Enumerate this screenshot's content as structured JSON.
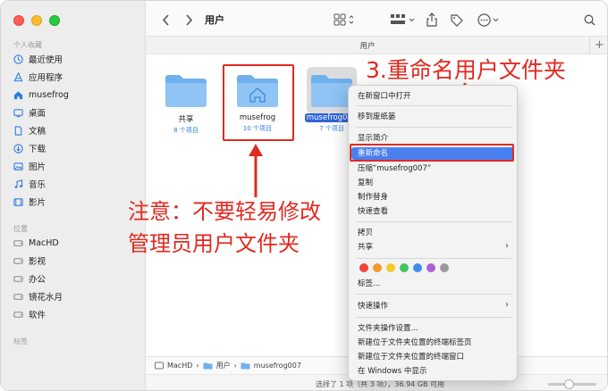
{
  "window": {
    "title": "用户",
    "path_header": "用户"
  },
  "sidebar": {
    "favorites_label": "个人收藏",
    "favorites": [
      {
        "label": "最近使用",
        "icon": "clock-icon"
      },
      {
        "label": "应用程序",
        "icon": "apps-icon"
      },
      {
        "label": "musefrog",
        "icon": "home-icon"
      },
      {
        "label": "桌面",
        "icon": "desktop-icon"
      },
      {
        "label": "文稿",
        "icon": "document-icon"
      },
      {
        "label": "下载",
        "icon": "download-icon"
      },
      {
        "label": "图片",
        "icon": "picture-icon"
      },
      {
        "label": "音乐",
        "icon": "music-icon"
      },
      {
        "label": "影片",
        "icon": "movie-icon"
      }
    ],
    "locations_label": "位置",
    "locations": [
      {
        "label": "MacHD",
        "icon": "disk-icon"
      },
      {
        "label": "影视",
        "icon": "disk-icon"
      },
      {
        "label": "办公",
        "icon": "disk-icon"
      },
      {
        "label": "镜花水月",
        "icon": "disk-icon"
      },
      {
        "label": "软件",
        "icon": "disk-icon"
      }
    ],
    "tags_label": "标签"
  },
  "folders": [
    {
      "name": "共享",
      "sub": "8 个项目"
    },
    {
      "name": "musefrog",
      "sub": "10 个项目"
    },
    {
      "name": "musefrog007",
      "sub": "7 个项目"
    }
  ],
  "annotations": {
    "step": "3.重命名用户文件夹",
    "note_line1": "注意：不要轻易修改",
    "note_line2": "管理员用户文件夹"
  },
  "context_menu": {
    "group1": [
      "在新窗口中打开"
    ],
    "group2": [
      "移到废纸篓"
    ],
    "group3": [
      "显示简介",
      "重新命名",
      "压缩“musefrog007”",
      "复制",
      "制作替身",
      "快速查看"
    ],
    "group4": [
      "拷贝",
      "共享"
    ],
    "tags_label": "标签...",
    "quick_actions": "快速操作",
    "group6": [
      "文件夹操作设置...",
      "新建位于文件夹位置的终端标签页",
      "新建位于文件夹位置的终端窗口",
      "在 Windows 中显示"
    ],
    "tag_colors": [
      "#f2443a",
      "#f39a28",
      "#f5cb2c",
      "#43c45a",
      "#3f8cf0",
      "#a95fd7",
      "#9a9a9a"
    ]
  },
  "pathbar": [
    "MacHD",
    "用户",
    "musefrog007"
  ],
  "status": "选择了 1 项（共 3 项），36.94 GB 可用"
}
